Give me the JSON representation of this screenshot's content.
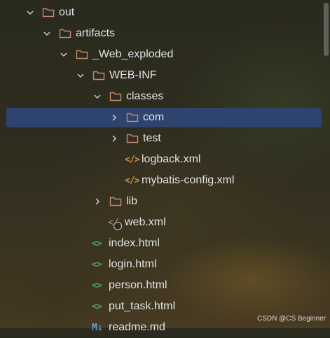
{
  "colors": {
    "selection": "#2e436e",
    "folder_stroke": "#c98a72",
    "xml_icon": "#d68a4a",
    "html_icon": "#4fa35b",
    "md_icon": "#6f9ad9",
    "text": "#dfe1e5"
  },
  "tree": {
    "items": [
      {
        "label": "out",
        "icon": "folder-icon",
        "expanded": true
      },
      {
        "label": "artifacts",
        "icon": "folder-icon",
        "expanded": true
      },
      {
        "label": "_Web_exploded",
        "icon": "folder-icon",
        "expanded": true
      },
      {
        "label": "WEB-INF",
        "icon": "folder-icon",
        "expanded": true
      },
      {
        "label": "classes",
        "icon": "folder-icon",
        "expanded": true
      },
      {
        "label": "com",
        "icon": "folder-icon",
        "expanded": false,
        "selected": true
      },
      {
        "label": "test",
        "icon": "folder-icon",
        "expanded": false
      },
      {
        "label": "logback.xml",
        "icon": "xml-file-icon",
        "glyph": "</>"
      },
      {
        "label": "mybatis-config.xml",
        "icon": "xml-file-icon",
        "glyph": "</>"
      },
      {
        "label": "lib",
        "icon": "folder-icon",
        "expanded": false
      },
      {
        "label": "web.xml",
        "icon": "web-xml-file-icon",
        "glyph": "</"
      },
      {
        "label": "index.html",
        "icon": "html-file-icon",
        "glyph": "<>"
      },
      {
        "label": "login.html",
        "icon": "html-file-icon",
        "glyph": "<>"
      },
      {
        "label": "person.html",
        "icon": "html-file-icon",
        "glyph": "<>"
      },
      {
        "label": "put_task.html",
        "icon": "html-file-icon",
        "glyph": "<>"
      },
      {
        "label": "readme.md",
        "icon": "markdown-file-icon",
        "glyph": "M↓"
      }
    ]
  },
  "watermark": "CSDN @CS Beginner"
}
